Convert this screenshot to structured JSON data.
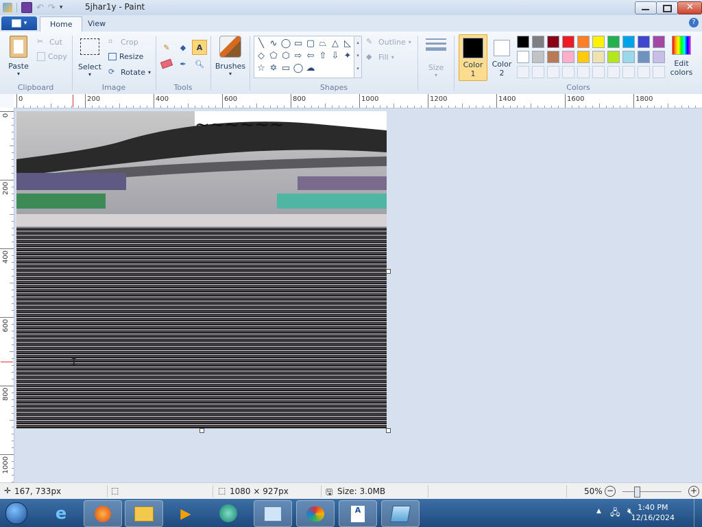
{
  "window": {
    "title": "5jhar1y - Paint"
  },
  "ribbon": {
    "file_button": "▾",
    "tabs": [
      {
        "label": "Home"
      },
      {
        "label": "View"
      }
    ],
    "clipboard": {
      "paste": "Paste",
      "cut": "Cut",
      "copy": "Copy",
      "label": "Clipboard"
    },
    "image": {
      "select": "Select",
      "crop": "Crop",
      "resize": "Resize",
      "rotate": "Rotate",
      "label": "Image"
    },
    "tools": {
      "label": "Tools"
    },
    "brushes": {
      "label": "Brushes"
    },
    "shapes": {
      "outline": "Outline",
      "fill": "Fill",
      "label": "Shapes"
    },
    "size": {
      "label": "Size"
    },
    "colors": {
      "color1": "Color 1",
      "color2": "Color 2",
      "edit": "Edit colors",
      "label": "Colors",
      "color1_value": "#000000",
      "color2_value": "#ffffff",
      "palette_row1": [
        "#000000",
        "#7f7f7f",
        "#880015",
        "#ed1c24",
        "#ff7f27",
        "#fff200",
        "#22b14c",
        "#00a2e8",
        "#3f48cc",
        "#a349a4"
      ],
      "palette_row2": [
        "#ffffff",
        "#c3c3c3",
        "#b97a57",
        "#ffaec9",
        "#ffc90e",
        "#efe4b0",
        "#b5e61d",
        "#99d9ea",
        "#7092be",
        "#c8bfe7"
      ]
    }
  },
  "rulers": {
    "horizontal": [
      "0",
      "200",
      "400",
      "600",
      "800",
      "1000",
      "1200",
      "1400",
      "1600",
      "1800"
    ],
    "vertical": [
      "0",
      "200",
      "400",
      "600",
      "800",
      "1000"
    ]
  },
  "statusbar": {
    "cursor_pos": "167, 733px",
    "dimensions": "1080 × 927px",
    "size": "Size: 3.0MB",
    "zoom": "50%"
  },
  "taskbar": {
    "time": "1:40 PM",
    "date": "12/16/2024"
  }
}
